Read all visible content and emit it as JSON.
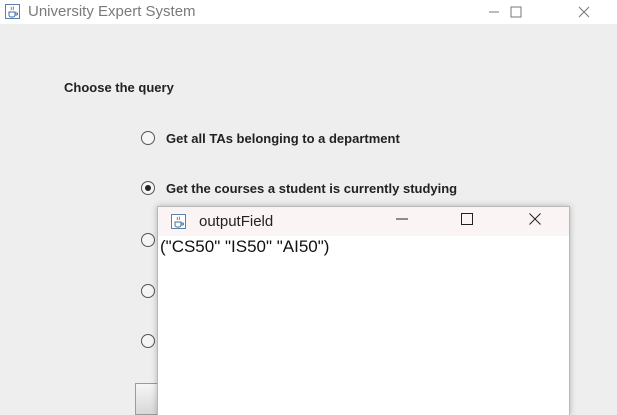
{
  "window": {
    "title": "University Expert System",
    "controls": [
      "minimize",
      "maximize",
      "close"
    ]
  },
  "main": {
    "query_label": "Choose the query",
    "options": [
      {
        "label": "Get all TAs belonging to a department",
        "selected": false
      },
      {
        "label": "Get the courses a student is currently studying",
        "selected": true
      },
      {
        "label": "",
        "selected": false
      },
      {
        "label": "",
        "selected": false
      },
      {
        "label": "",
        "selected": false
      }
    ]
  },
  "dialog": {
    "title": "outputField",
    "output": "(\"CS50\" \"IS50\" \"AI50\")"
  },
  "icons": {
    "app": "java-cup-icon",
    "minimize": "minimize-icon",
    "maximize": "maximize-icon",
    "close": "close-icon"
  }
}
